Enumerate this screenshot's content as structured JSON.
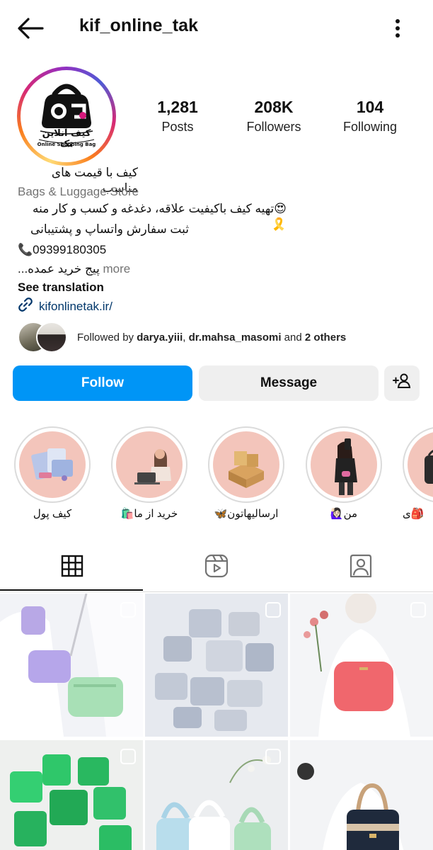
{
  "header": {
    "username": "kif_online_tak"
  },
  "profile": {
    "avatar_brand_text": "کیف آنلاین تک",
    "avatar_tagline": "Online Shopping Bag",
    "stats": [
      {
        "value": "1,281",
        "label": "Posts"
      },
      {
        "value": "208K",
        "label": "Followers"
      },
      {
        "value": "104",
        "label": "Following"
      }
    ]
  },
  "bio": {
    "name": "کیف با قیمت های مناسب",
    "category": "Bags & Luggage Store",
    "line1": "😍تهیه کیف باکیفیت علاقه، دغدغه و کسب و کار منه 🎗️",
    "line2": "ثبت سفارش واتساپ و پشتیبانی",
    "phone": "📞09399180305",
    "line4": "پیج خرید عمده...",
    "more": " more",
    "see_translation": "See translation",
    "link": "kifonlinetak.ir/"
  },
  "followed_by": {
    "prefix": "Followed by ",
    "user1": "darya.yiii",
    "sep": ", ",
    "user2": "dr.mahsa_masomi",
    "and": " and ",
    "others": "2 others"
  },
  "actions": {
    "follow": "Follow",
    "message": "Message"
  },
  "highlights": [
    {
      "label": "کیف پول"
    },
    {
      "label": "خرید از ما🛍️"
    },
    {
      "label": "ارسالیهاتون🦋"
    },
    {
      "label": "من🙋🏻‍♀️"
    },
    {
      "label": "🎒ی"
    }
  ],
  "tabs": {
    "active": "grid"
  },
  "colors": {
    "accent": "#0095f6",
    "highlight_bg": "#f3c5bb",
    "link": "#00376b"
  }
}
